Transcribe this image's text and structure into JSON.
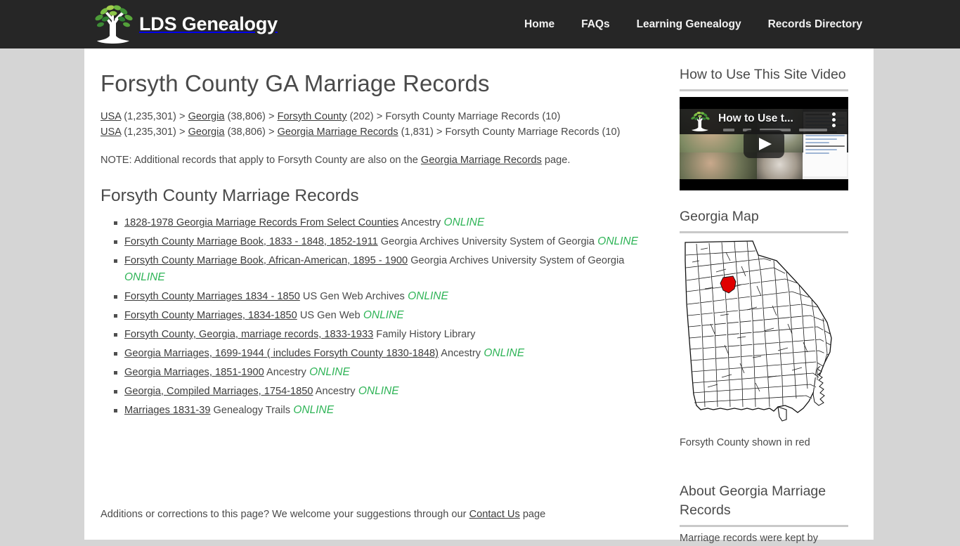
{
  "colors": {
    "header_bg": "#262626",
    "page_bg": "#d5d5d5",
    "content_bg": "#ffffff",
    "online_green": "#2fb457",
    "map_highlight_red": "#e00000",
    "text": "#4a4a4a",
    "rule": "#c9c9c9"
  },
  "header": {
    "brand_name": "LDS Genealogy",
    "logo_icon": "tree-logo-icon",
    "nav": [
      {
        "label": "Home",
        "name": "nav-home"
      },
      {
        "label": "FAQs",
        "name": "nav-faqs"
      },
      {
        "label": "Learning Genealogy",
        "name": "nav-learning-genealogy"
      },
      {
        "label": "Records Directory",
        "name": "nav-records-directory"
      }
    ]
  },
  "main": {
    "page_title": "Forsyth County GA Marriage Records",
    "breadcrumb1": {
      "l1": "USA",
      "c1": "(1,235,301)",
      "sep1": ">",
      "l2": "Georgia",
      "c2": "(38,806)",
      "sep2": ">",
      "l3": "Forsyth County",
      "c3": "(202)",
      "sep3": ">",
      "tail": "Forsyth County Marriage Records (10)"
    },
    "breadcrumb2": {
      "l1": "USA",
      "c1": "(1,235,301)",
      "sep1": ">",
      "l2": "Georgia",
      "c2": "(38,806)",
      "sep2": ">",
      "l3": "Georgia Marriage Records",
      "c3": "(1,831)",
      "sep3": ">",
      "tail": "Forsyth County Marriage Records (10)"
    },
    "note": {
      "before": "NOTE: Additional records that apply to Forsyth County are also on the ",
      "link": "Georgia Marriage Records",
      "after": " page."
    },
    "section_title": "Forsyth County Marriage Records",
    "records": [
      {
        "link": "1828-1978 Georgia Marriage Records From Select Counties",
        "source": "Ancestry",
        "badge": "ONLINE"
      },
      {
        "link": "Forsyth County Marriage Book, 1833 - 1848, 1852-1911",
        "source": "Georgia Archives University System of Georgia",
        "badge": "ONLINE"
      },
      {
        "link": "Forsyth County Marriage Book, African-American, 1895 - 1900",
        "source": "Georgia Archives University System of Georgia",
        "badge": "ONLINE"
      },
      {
        "link": "Forsyth County Marriages 1834 - 1850",
        "source": "US Gen Web Archives",
        "badge": "ONLINE"
      },
      {
        "link": "Forsyth County Marriages, 1834-1850",
        "source": "US Gen Web",
        "badge": "ONLINE"
      },
      {
        "link": "Forsyth County, Georgia, marriage records, 1833-1933",
        "source": "Family History Library",
        "badge": ""
      },
      {
        "link": "Georgia Marriages, 1699-1944 ( includes Forsyth County 1830-1848)",
        "source": "Ancestry",
        "badge": "ONLINE"
      },
      {
        "link": "Georgia Marriages, 1851-1900",
        "source": "Ancestry",
        "badge": "ONLINE"
      },
      {
        "link": "Georgia, Compiled Marriages, 1754-1850",
        "source": "Ancestry",
        "badge": "ONLINE"
      },
      {
        "link": "Marriages 1831-39",
        "source": "Genealogy Trails",
        "badge": "ONLINE"
      }
    ],
    "footer_note": {
      "before": "Additions or corrections to this page? We welcome your suggestions through our ",
      "link": "Contact Us",
      "after": " page"
    }
  },
  "sidebar": {
    "video_section_title": "How to Use This Site Video",
    "video": {
      "overlay_title": "How to Use t...",
      "logo_icon": "tree-logo-icon",
      "play_icon": "play-button-icon",
      "menu_icon": "kebab-menu-icon"
    },
    "map_section_title": "Georgia Map",
    "map_caption": "Forsyth County shown in red",
    "map_alt": "georgia-county-map",
    "about_section_title": "About Georgia Marriage Records",
    "about_text": "Marriage records were kept by"
  }
}
